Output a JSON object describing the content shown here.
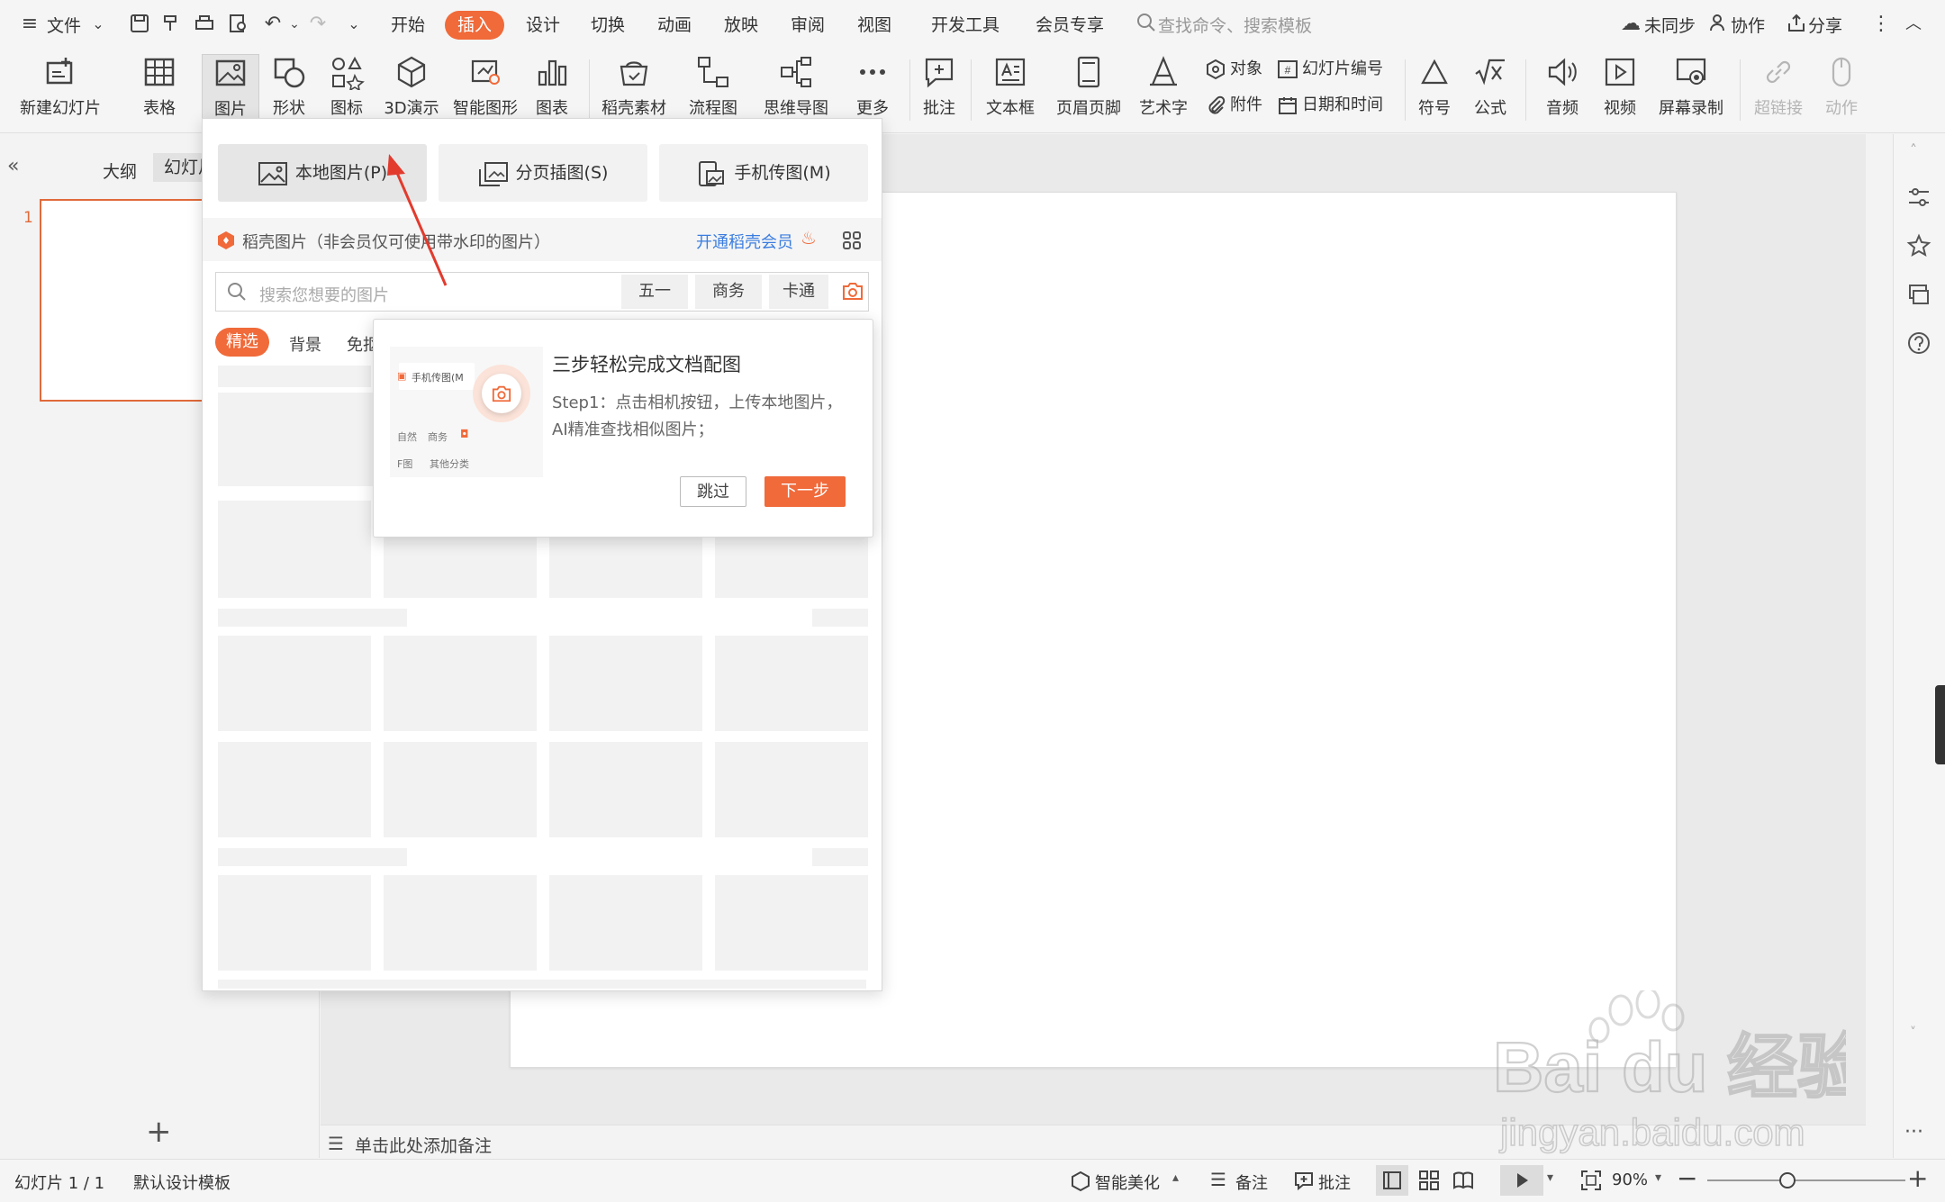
{
  "menu": {
    "file": "文件",
    "tabs": [
      "开始",
      "插入",
      "设计",
      "切换",
      "动画",
      "放映",
      "审阅",
      "视图",
      "开发工具",
      "会员专享"
    ],
    "active_tab": "插入",
    "search_placeholder": "查找命令、搜索模板",
    "sync": "未同步",
    "collab": "协作",
    "share": "分享"
  },
  "ribbon": {
    "new_slide": "新建幻灯片",
    "table": "表格",
    "picture": "图片",
    "shape": "形状",
    "icon": "图标",
    "three_d": "3D演示",
    "smartart": "智能图形",
    "chart": "图表",
    "daoke": "稻壳素材",
    "flowchart": "流程图",
    "mindmap": "思维导图",
    "more": "更多",
    "comment": "批注",
    "textbox": "文本框",
    "header_footer": "页眉页脚",
    "wordart": "艺术字",
    "object": "对象",
    "attachment": "附件",
    "slide_number": "幻灯片编号",
    "datetime": "日期和时间",
    "symbol": "符号",
    "formula": "公式",
    "audio": "音频",
    "video": "视频",
    "screen_record": "屏幕录制",
    "hyperlink": "超链接",
    "action": "动作"
  },
  "leftpanel": {
    "outline_tab": "大纲",
    "slides_tab": "幻灯片",
    "slide_number": "1",
    "add": "+"
  },
  "dropdown": {
    "local_picture": "本地图片(P)",
    "page_insert": "分页插图(S)",
    "phone_transfer": "手机传图(M)",
    "daoke_label": "稻壳图片（非会员仅可使用带水印的图片）",
    "vip_link": "开通稻壳会员",
    "search_placeholder": "搜索您想要的图片",
    "chips": [
      "五一",
      "商务",
      "卡通"
    ],
    "filter_tabs": [
      "精选",
      "背景",
      "免抠"
    ]
  },
  "popover": {
    "title": "三步轻松完成文档配图",
    "body_line1": "Step1：点击相机按钮，上传本地图片，",
    "body_line2": "AI精准查找相似图片；",
    "skip": "跳过",
    "next": "下一步",
    "mini_phone": "手机传图(M",
    "mini_nature": "自然",
    "mini_business": "商务",
    "mini_f": "F图",
    "mini_other": "其他分类"
  },
  "notes": {
    "placeholder": "单击此处添加备注"
  },
  "status": {
    "slide_count": "幻灯片 1 / 1",
    "template": "默认设计模板",
    "smart_beautify": "智能美化",
    "notes": "备注",
    "comment": "批注",
    "zoom": "90%"
  },
  "watermark": {
    "brand": "Bai du 经验",
    "url": "jingyan.baidu.com"
  },
  "colors": {
    "accent": "#f06a3a",
    "link": "#3a7de0"
  }
}
